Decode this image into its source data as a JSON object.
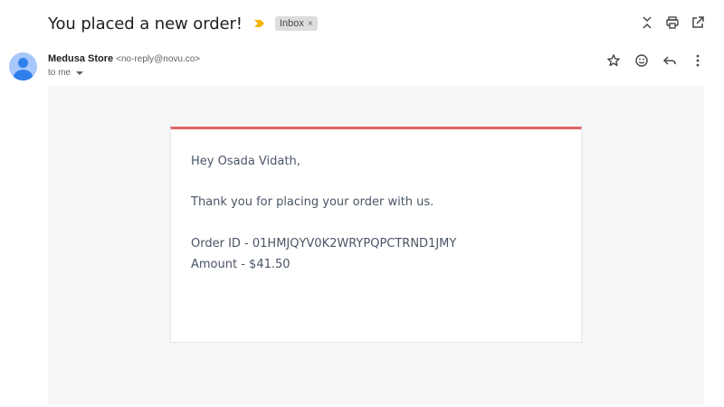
{
  "header": {
    "subject": "You placed a new order!",
    "label": "Inbox",
    "label_close": "×"
  },
  "sender": {
    "name": "Medusa Store",
    "email": "<no-reply@novu.co>",
    "to": "to me"
  },
  "body": {
    "greeting": "Hey Osada Vidath,",
    "thanks": "Thank you for placing your order with us.",
    "order_id": "Order ID - 01HMJQYV0K2WRYPQPCTRND1JMY",
    "amount": "Amount - $41.50"
  },
  "colors": {
    "accent_bar": "#e06666",
    "importance_marker": "#f4b400",
    "body_background": "#f6f6f6"
  },
  "icons": {
    "top_actions": [
      "collapse-icon",
      "print-icon",
      "open-new-window-icon"
    ],
    "message_actions": [
      "star-icon",
      "emoji-icon",
      "reply-icon",
      "more-vert-icon"
    ]
  }
}
